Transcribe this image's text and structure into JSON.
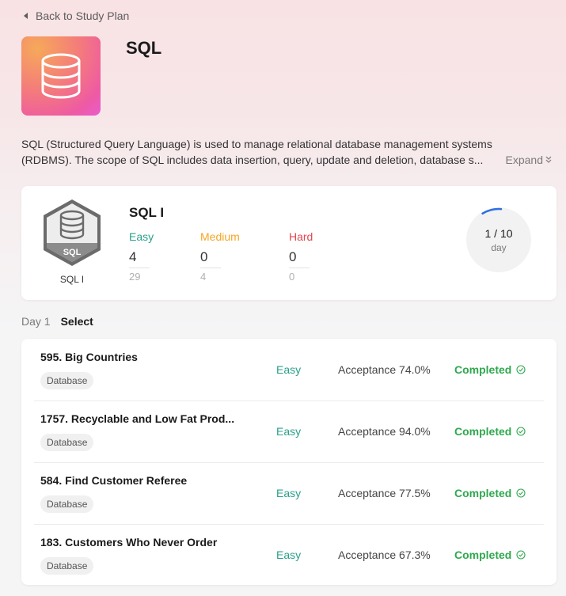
{
  "nav": {
    "back_label": "Back to Study Plan"
  },
  "plan": {
    "title": "SQL",
    "description_line1": "SQL (Structured Query Language) is used to manage relational database management systems",
    "description_line2": "(RDBMS). The scope of SQL includes data insertion, query, update and deletion, database s...",
    "expand_label": "Expand"
  },
  "card": {
    "badge_text": "SQL",
    "badge_label": "SQL I",
    "title": "SQL I",
    "stats": [
      {
        "label": "Easy",
        "value": "4",
        "total": "29"
      },
      {
        "label": "Medium",
        "value": "0",
        "total": "4"
      },
      {
        "label": "Hard",
        "value": "0",
        "total": "0"
      }
    ],
    "progress": {
      "text": "1 / 10",
      "unit": "day",
      "current": 1,
      "total": 10
    }
  },
  "day": {
    "label": "Day 1",
    "select_label": "Select"
  },
  "problems": [
    {
      "name": "595. Big Countries",
      "tag": "Database",
      "difficulty": "Easy",
      "acceptance": "Acceptance 74.0%",
      "status": "Completed"
    },
    {
      "name": "1757. Recyclable and Low Fat Prod...",
      "tag": "Database",
      "difficulty": "Easy",
      "acceptance": "Acceptance 94.0%",
      "status": "Completed"
    },
    {
      "name": "584. Find Customer Referee",
      "tag": "Database",
      "difficulty": "Easy",
      "acceptance": "Acceptance 77.5%",
      "status": "Completed"
    },
    {
      "name": "183. Customers Who Never Order",
      "tag": "Database",
      "difficulty": "Easy",
      "acceptance": "Acceptance 67.3%",
      "status": "Completed"
    }
  ],
  "colors": {
    "easy": "#2aa08a",
    "medium": "#f5a623",
    "hard": "#e0464e",
    "completed": "#2fa84f",
    "progress": "#2f6fe4"
  }
}
